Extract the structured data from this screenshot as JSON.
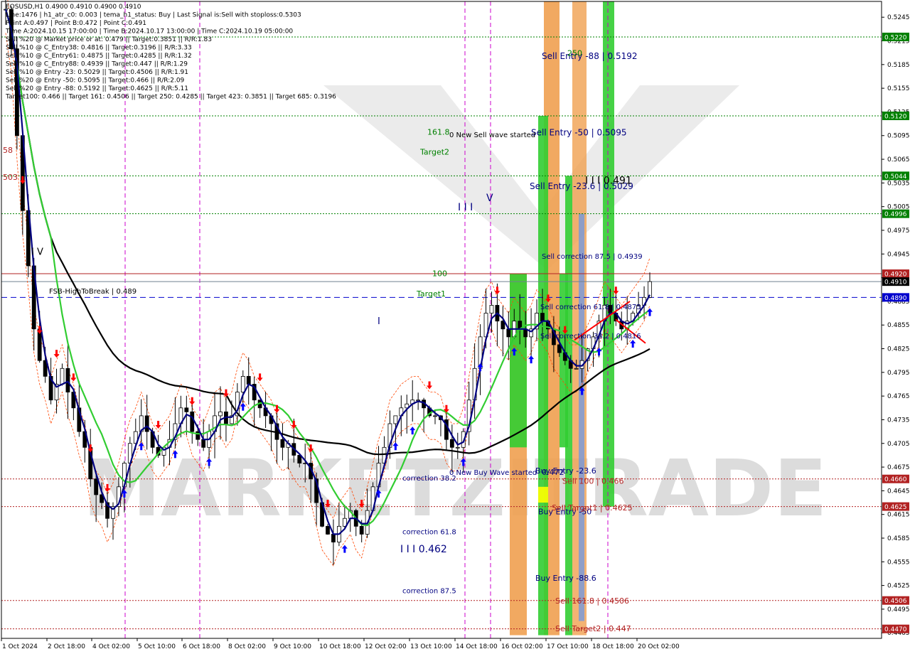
{
  "header": {
    "lines": [
      "EOSUSD,H1  0.4900 0.4910 0.4900 0.4910",
      "Line:1476 | h1_atr_c0: 0.003 | tema_h1_status: Buy | Last Signal is:Sell with stoploss:0.5303",
      "Point A:0.497 | Point B:0.472 | Point C:0.491",
      "Time A:2024.10.15 17:00:00 | Time B:2024.10.17 13:00:00 | Time C:2024.10.19 05:00:00",
      "Sell %20 @ Market price or at: 0.479 || Target:0.3851 || R/R:1.83",
      "Sell %10 @ C_Entry38: 0.4816 || Target:0.3196 || R/R:3.33",
      "Sell %10 @ C_Entry61: 0.4875 || Target:0.4285 || R/R:1.32",
      "Sell %10 @ C_Entry88: 0.4939 || Target:0.447 || R/R:1.29",
      "Sell %10 @ Entry -23: 0.5029 || Target:0.4506 || R/R:1.91",
      "Sell %20 @ Entry -50: 0.5095 || Target:0.466 || R/R:2.09",
      "Sell %20 @ Entry -88: 0.5192 || Target:0.4625 || R/R:5.11",
      "Target100: 0.466 || Target 161: 0.4506 || Target 250: 0.4285 || Target 423: 0.3851 || Target 685: 0.3196"
    ]
  },
  "colors": {
    "background": "#ffffff",
    "candle": "#000000",
    "tema_fast": "#000080",
    "ma_green": "#32cd32",
    "ma_slow": "#000000",
    "envelope": "#ff4500",
    "level_green": "#008000",
    "level_red": "#b22222",
    "current_price": "#708090",
    "break_line": "#0000cd",
    "vline": "#cc00cc",
    "band_green": "#32cd32",
    "band_orange": "#f0a050",
    "band_blue": "#6495ed",
    "band_yellow": "#ffff00",
    "arrow_buy": "#0000ff",
    "arrow_sell": "#ff0000"
  },
  "chart_data": {
    "type": "candlestick",
    "symbol": "EOSUSD",
    "timeframe": "H1",
    "ylim": [
      0.4458,
      0.5265
    ],
    "x_ticks": [
      "1 Oct 2024",
      "2 Oct 18:00",
      "4 Oct 02:00",
      "5 Oct 10:00",
      "6 Oct 18:00",
      "8 Oct 02:00",
      "9 Oct 10:00",
      "10 Oct 18:00",
      "12 Oct 02:00",
      "13 Oct 10:00",
      "14 Oct 18:00",
      "16 Oct 02:00",
      "17 Oct 10:00",
      "18 Oct 18:00",
      "20 Oct 02:00"
    ],
    "y_ticks": [
      "0.5245",
      "0.5215",
      "0.5185",
      "0.5155",
      "0.5125",
      "0.5095",
      "0.5065",
      "0.5035",
      "0.5005",
      "0.4975",
      "0.4945",
      "0.4915",
      "0.4885",
      "0.4855",
      "0.4825",
      "0.4795",
      "0.4765",
      "0.4735",
      "0.4705",
      "0.4675",
      "0.4645",
      "0.4615",
      "0.4585",
      "0.4555",
      "0.4525",
      "0.4495",
      "0.4465"
    ],
    "price_levels": [
      {
        "label": "0.5220",
        "value": 0.522,
        "color": "green",
        "style": "dotted"
      },
      {
        "label": "0.5120",
        "value": 0.512,
        "color": "green",
        "style": "dotted"
      },
      {
        "label": "0.5044",
        "value": 0.5044,
        "color": "green",
        "style": "dotted"
      },
      {
        "label": "0.4996",
        "value": 0.4996,
        "color": "green",
        "style": "dotted"
      },
      {
        "label": "0.4920",
        "value": 0.492,
        "color": "red",
        "style": "solid"
      },
      {
        "label": "0.4910",
        "value": 0.491,
        "color": "current",
        "style": "solid"
      },
      {
        "label": "0.4890",
        "value": 0.489,
        "color": "blue",
        "style": "dashed"
      },
      {
        "label": "0.4660",
        "value": 0.466,
        "color": "red",
        "style": "dotted"
      },
      {
        "label": "0.4625",
        "value": 0.4625,
        "color": "red",
        "style": "dotted"
      },
      {
        "label": "0.4506",
        "value": 0.4506,
        "color": "red",
        "style": "dotted"
      },
      {
        "label": "0.4470",
        "value": 0.447,
        "color": "red",
        "style": "dotted"
      }
    ],
    "candles_close": [
      0.5255,
      0.5205,
      0.5095,
      0.5,
      0.493,
      0.485,
      0.481,
      0.479,
      0.476,
      0.478,
      0.48,
      0.477,
      0.475,
      0.472,
      0.47,
      0.466,
      0.464,
      0.463,
      0.461,
      0.4625,
      0.465,
      0.468,
      0.4705,
      0.472,
      0.474,
      0.472,
      0.47,
      0.469,
      0.47,
      0.471,
      0.473,
      0.475,
      0.4745,
      0.472,
      0.471,
      0.47,
      0.472,
      0.474,
      0.4745,
      0.473,
      0.474,
      0.477,
      0.479,
      0.478,
      0.476,
      0.475,
      0.474,
      0.473,
      0.471,
      0.47,
      0.4705,
      0.469,
      0.468,
      0.468,
      0.466,
      0.463,
      0.46,
      0.459,
      0.458,
      0.46,
      0.461,
      0.462,
      0.46,
      0.459,
      0.462,
      0.465,
      0.468,
      0.47,
      0.473,
      0.474,
      0.475,
      0.4755,
      0.476,
      0.476,
      0.475,
      0.474,
      0.474,
      0.4735,
      0.471,
      0.47,
      0.47,
      0.472,
      0.476,
      0.48,
      0.484,
      0.487,
      0.488,
      0.486,
      0.485,
      0.484,
      0.486,
      0.485,
      0.484,
      0.485,
      0.487,
      0.486,
      0.485,
      0.483,
      0.482,
      0.481,
      0.48,
      0.48,
      0.481,
      0.4825,
      0.484,
      0.486,
      0.488,
      0.487,
      0.486,
      0.485,
      0.486,
      0.487,
      0.488,
      0.489,
      0.491
    ],
    "annotations": [
      "FSB-HighToBreak | 0.489",
      "Sell Entry -88 | 0.5192",
      "Sell Entry -50 | 0.5095",
      "Sell Entry -23.6 | 0.5029",
      "Sell correction 87.5 | 0.4939",
      "Sell correction 61.8 | 0.4875",
      "Sell correction 38.2 | 0.4816",
      "correction 38.2",
      "correction 61.8",
      "correction 87.5",
      "Buy Entry -23.6",
      "Buy Entry -50",
      "Buy Entry -88.6",
      "Sell 100 | 0.466",
      "Sell Target1 | 0.4625",
      "Sell 161.8 | 0.4506",
      "Sell Target2 | 0.447",
      "0 New Sell wave started",
      "0 New Buy Wave started",
      "I I I 0.491",
      "I I I 0.462",
      "I V",
      "I I I",
      "V",
      "Target1",
      "Target2",
      "161.8",
      "250",
      "100",
      "I",
      "0.472",
      "58",
      "503"
    ],
    "grid": false,
    "legend": "none"
  },
  "watermark": {
    "text": "MARKETZITRADE"
  }
}
